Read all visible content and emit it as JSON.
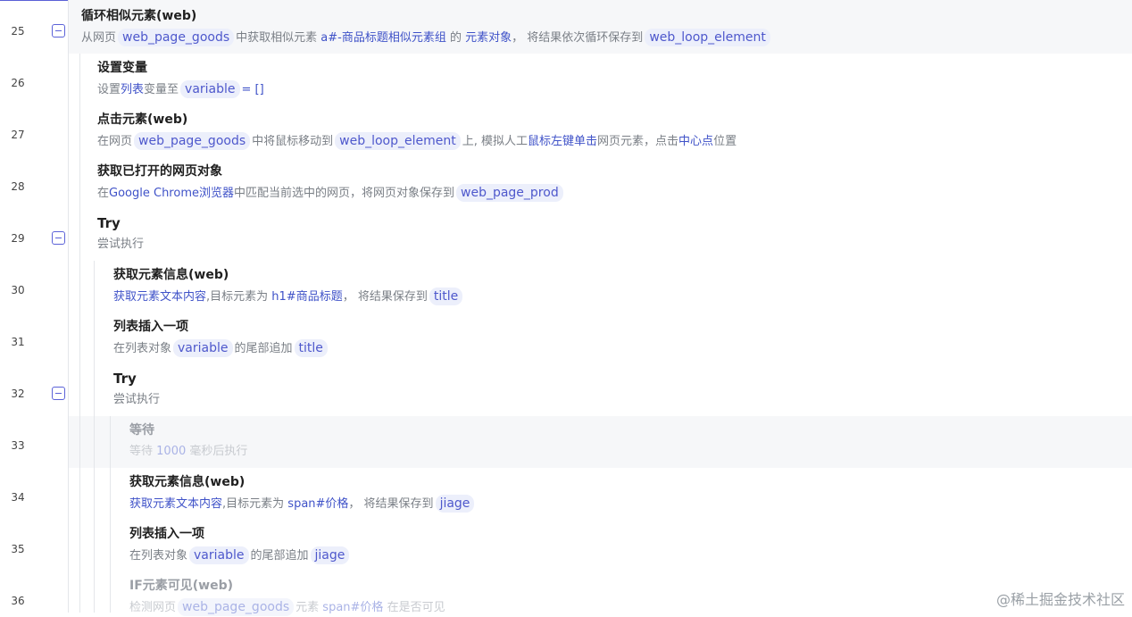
{
  "line_numbers": [
    "25",
    "26",
    "27",
    "28",
    "29",
    "30",
    "31",
    "32",
    "33",
    "34",
    "35",
    "36"
  ],
  "steps": [
    {
      "title": "循环相似元素(web)",
      "desc": {
        "a": "从网页",
        "b": "web_page_goods",
        "c": "中获取相似元素",
        "d": "a#-商品标题相似元素组",
        "e": "的",
        "f": "元素对象",
        "g": "， 将结果依次循环保存到",
        "h": "web_loop_element"
      }
    },
    {
      "title": "设置变量",
      "desc": {
        "a": "设置",
        "b": "列表",
        "c": "变量至",
        "d": "variable",
        "e": "= []"
      }
    },
    {
      "title": "点击元素(web)",
      "desc": {
        "a": "在网页",
        "b": "web_page_goods",
        "c": "中将鼠标移动到",
        "d": "web_loop_element",
        "e": "上, 模拟人工",
        "f": "鼠标左键单击",
        "g": "网页元素，点击",
        "h": "中心点",
        "i": "位置"
      }
    },
    {
      "title": "获取已打开的网页对象",
      "desc": {
        "a": "在",
        "b": "Google Chrome浏览器",
        "c": "中匹配当前选中的网页，将网页对象保存到",
        "d": "web_page_prod"
      }
    },
    {
      "title": "Try",
      "desc": {
        "a": "尝试执行"
      }
    },
    {
      "title": "获取元素信息(web)",
      "desc": {
        "a": "获取元素文本内容",
        "b": ",目标元素为",
        "c": "h1#商品标题",
        "d": "， 将结果保存到",
        "e": "title"
      }
    },
    {
      "title": "列表插入一项",
      "desc": {
        "a": "在列表对象",
        "b": "variable",
        "c": "的尾部追加",
        "d": "title"
      }
    },
    {
      "title": "Try",
      "desc": {
        "a": "尝试执行"
      }
    },
    {
      "title": "等待",
      "desc": {
        "a": "等待",
        "b": "1000",
        "c": "毫秒后执行"
      }
    },
    {
      "title": "获取元素信息(web)",
      "desc": {
        "a": "获取元素文本内容",
        "b": ",目标元素为",
        "c": "span#价格",
        "d": "， 将结果保存到",
        "e": "jiage"
      }
    },
    {
      "title": "列表插入一项",
      "desc": {
        "a": "在列表对象",
        "b": "variable",
        "c": "的尾部追加",
        "d": "jiage"
      }
    },
    {
      "title": "IF元素可见(web)",
      "desc": {
        "a": "检测网页",
        "b": "web_page_goods",
        "c": "元素",
        "d": "span#价格",
        "e": "在是否可见"
      }
    }
  ],
  "watermark": "@稀土掘金技术社区",
  "colors": {
    "accent": "#5b62d8",
    "keyword": "#3f52c8",
    "pill_bg": "#eceffb",
    "highlight_row": "#f6f7f9"
  }
}
